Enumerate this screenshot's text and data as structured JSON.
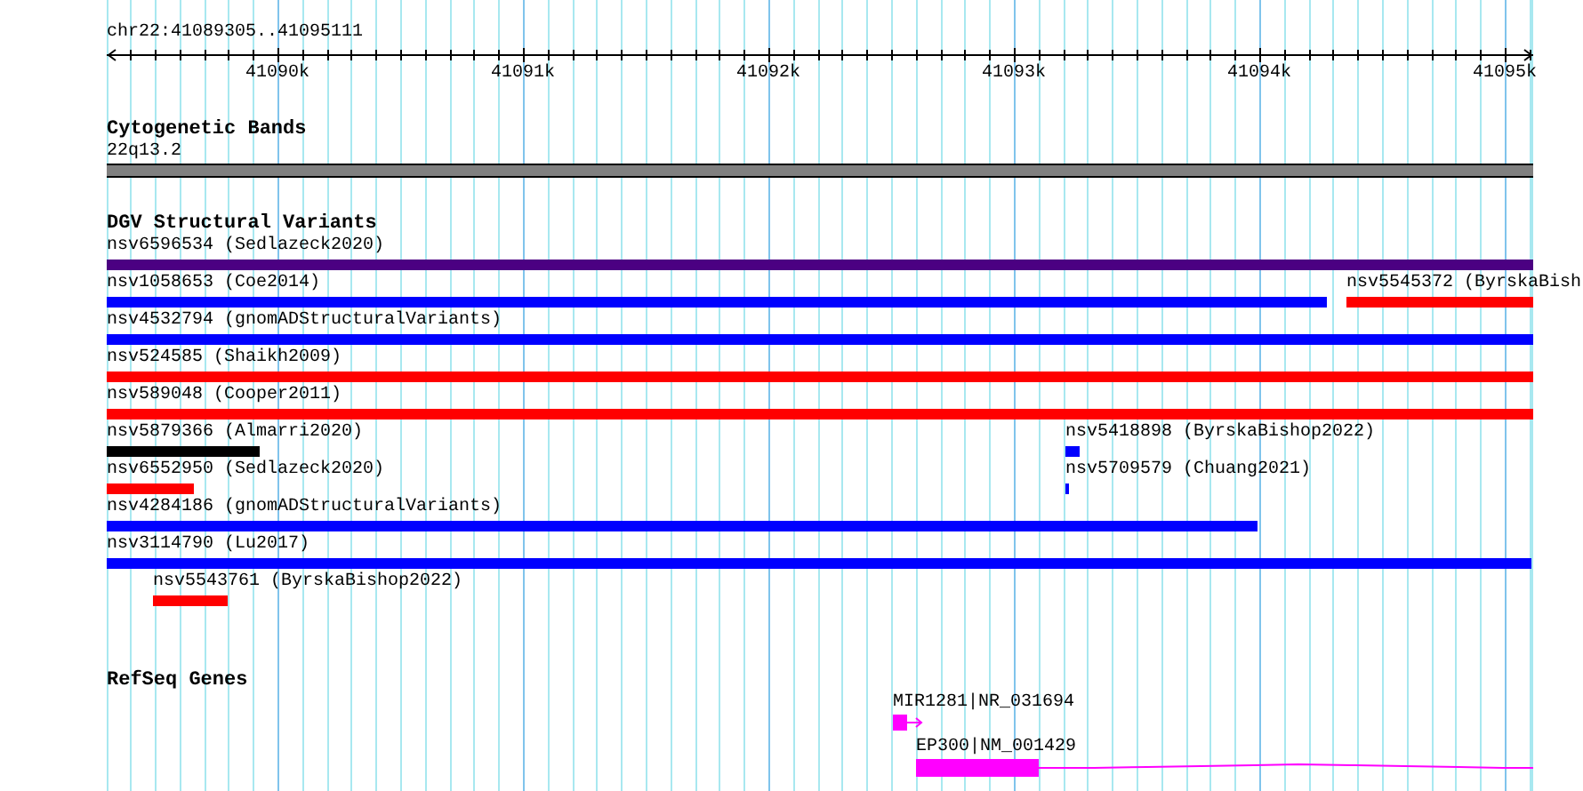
{
  "ruler": {
    "locus": "chr22:41089305..41095111",
    "labels": [
      "41090k",
      "41091k",
      "41092k",
      "41093k",
      "41094k",
      "41095k"
    ]
  },
  "cytobands": {
    "title": "Cytogenetic Bands",
    "band": "22q13.2"
  },
  "dgv": {
    "title": "DGV Structural Variants",
    "rows": [
      {
        "features": [
          {
            "label": "nsv6596534 (Sedlazeck2020)",
            "color": "#4b0082"
          }
        ]
      },
      {
        "features": [
          {
            "label": "nsv1058653 (Coe2014)",
            "color": "#0000ff"
          },
          {
            "label": "nsv5545372 (ByrskaBish",
            "color": "#ff0000"
          }
        ]
      },
      {
        "features": [
          {
            "label": "nsv4532794 (gnomADStructuralVariants)",
            "color": "#0000ff"
          }
        ]
      },
      {
        "features": [
          {
            "label": "nsv524585 (Shaikh2009)",
            "color": "#ff0000"
          }
        ]
      },
      {
        "features": [
          {
            "label": "nsv589048 (Cooper2011)",
            "color": "#ff0000"
          }
        ]
      },
      {
        "features": [
          {
            "label": "nsv5879366 (Almarri2020)",
            "color": "#000000"
          },
          {
            "label": "nsv5418898 (ByrskaBishop2022)",
            "color": "#0000ff"
          }
        ]
      },
      {
        "features": [
          {
            "label": "nsv6552950 (Sedlazeck2020)",
            "color": "#ff0000"
          },
          {
            "label": "nsv5709579 (Chuang2021)",
            "color": "#0000ff"
          }
        ]
      },
      {
        "features": [
          {
            "label": "nsv4284186 (gnomADStructuralVariants)",
            "color": "#0000ff"
          }
        ]
      },
      {
        "features": [
          {
            "label": "nsv3114790 (Lu2017)",
            "color": "#0000ff"
          }
        ]
      },
      {
        "features": [
          {
            "label": "nsv5543761 (ByrskaBishop2022)",
            "color": "#ff0000"
          }
        ]
      }
    ]
  },
  "refseq": {
    "title": "RefSeq Genes",
    "genes": [
      {
        "label": "MIR1281|NR_031694",
        "kind": "mirna"
      },
      {
        "label": "EP300|NM_001429",
        "kind": "gene"
      }
    ]
  }
}
